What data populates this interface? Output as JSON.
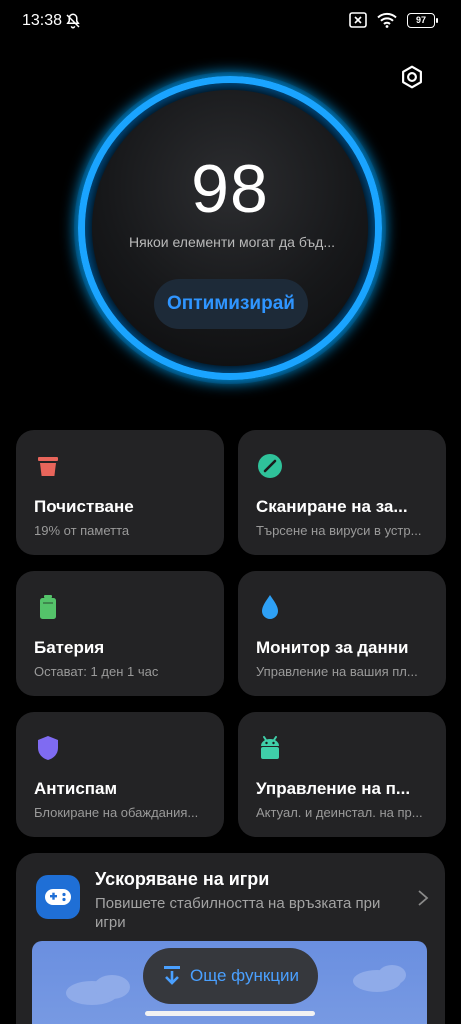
{
  "status_bar": {
    "time": "13:38",
    "left_icon": "mute-icon",
    "right_icons": [
      "sim-crossed-icon",
      "wifi-icon"
    ],
    "battery_level": "97"
  },
  "header": {
    "settings_icon": "gear-icon"
  },
  "score_panel": {
    "score": "98",
    "subtitle": "Някои елементи могат да бъд...",
    "optimize_label": "Оптимизирай",
    "ring_color": "#1aa4ff"
  },
  "cards": [
    {
      "title": "Почистване",
      "subtitle": "19% от паметта",
      "icon": "trash-icon",
      "icon_color": "#e8655b"
    },
    {
      "title": "Сканиране на за...",
      "subtitle": "Търсене на вируси в устр...",
      "icon": "scan-icon",
      "icon_color": "#2fc29a"
    },
    {
      "title": "Батерия",
      "subtitle": "Остават: 1 ден 1 час",
      "icon": "battery-icon",
      "icon_color": "#54c36a"
    },
    {
      "title": "Монитор за данни",
      "subtitle": "Управление на вашия пл...",
      "icon": "droplet-icon",
      "icon_color": "#2ea0f5"
    },
    {
      "title": "Антиспам",
      "subtitle": "Блокиране на обаждания...",
      "icon": "shield-icon",
      "icon_color": "#7f6bf2"
    },
    {
      "title": "Управление на п...",
      "subtitle": "Актуал. и деинстал. на пр...",
      "icon": "android-icon",
      "icon_color": "#3fcfa9"
    }
  ],
  "game_boost": {
    "title": "Ускоряване на игри",
    "subtitle": "Повишете стабилността на връзката при игри",
    "icon": "gamepad-icon"
  },
  "more_features": {
    "label": "Още функции",
    "icon": "download-arrow-icon"
  }
}
